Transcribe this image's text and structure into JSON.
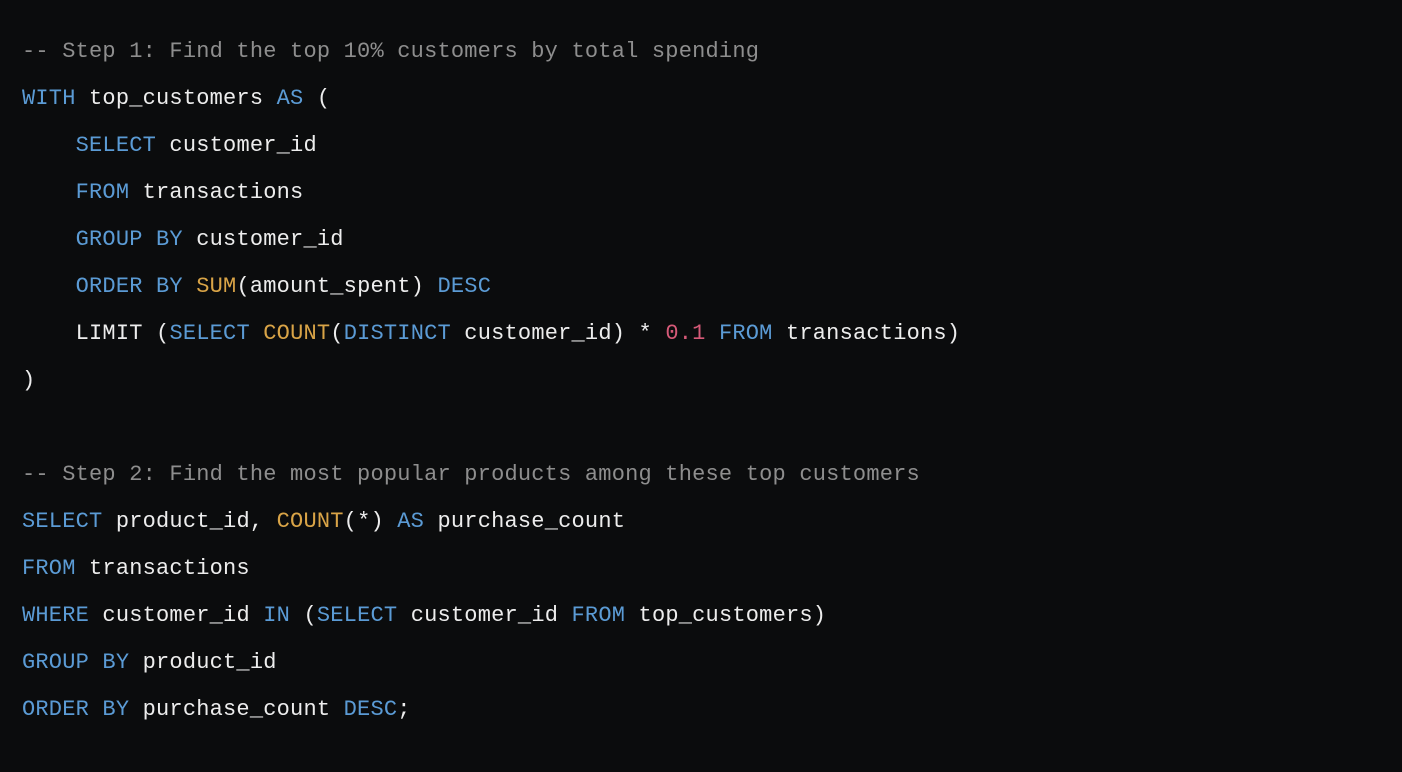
{
  "code": {
    "lines": [
      [
        {
          "cls": "tok-comment",
          "text": "-- Step 1: Find the top 10% customers by total spending"
        }
      ],
      [
        {
          "cls": "tok-keyword",
          "text": "WITH"
        },
        {
          "cls": "tok-default",
          "text": " top_customers "
        },
        {
          "cls": "tok-keyword",
          "text": "AS"
        },
        {
          "cls": "tok-default",
          "text": " ("
        }
      ],
      [
        {
          "cls": "tok-default",
          "text": "    "
        },
        {
          "cls": "tok-keyword",
          "text": "SELECT"
        },
        {
          "cls": "tok-default",
          "text": " customer_id"
        }
      ],
      [
        {
          "cls": "tok-default",
          "text": "    "
        },
        {
          "cls": "tok-keyword",
          "text": "FROM"
        },
        {
          "cls": "tok-default",
          "text": " transactions"
        }
      ],
      [
        {
          "cls": "tok-default",
          "text": "    "
        },
        {
          "cls": "tok-keyword",
          "text": "GROUP BY"
        },
        {
          "cls": "tok-default",
          "text": " customer_id"
        }
      ],
      [
        {
          "cls": "tok-default",
          "text": "    "
        },
        {
          "cls": "tok-keyword",
          "text": "ORDER BY"
        },
        {
          "cls": "tok-default",
          "text": " "
        },
        {
          "cls": "tok-func",
          "text": "SUM"
        },
        {
          "cls": "tok-default",
          "text": "(amount_spent) "
        },
        {
          "cls": "tok-keyword",
          "text": "DESC"
        }
      ],
      [
        {
          "cls": "tok-default",
          "text": "    LIMIT ("
        },
        {
          "cls": "tok-keyword",
          "text": "SELECT"
        },
        {
          "cls": "tok-default",
          "text": " "
        },
        {
          "cls": "tok-func",
          "text": "COUNT"
        },
        {
          "cls": "tok-default",
          "text": "("
        },
        {
          "cls": "tok-keyword",
          "text": "DISTINCT"
        },
        {
          "cls": "tok-default",
          "text": " customer_id) * "
        },
        {
          "cls": "tok-number",
          "text": "0.1"
        },
        {
          "cls": "tok-default",
          "text": " "
        },
        {
          "cls": "tok-keyword",
          "text": "FROM"
        },
        {
          "cls": "tok-default",
          "text": " transactions)"
        }
      ],
      [
        {
          "cls": "tok-default",
          "text": ")"
        }
      ],
      [
        {
          "cls": "tok-default",
          "text": ""
        }
      ],
      [
        {
          "cls": "tok-comment",
          "text": "-- Step 2: Find the most popular products among these top customers"
        }
      ],
      [
        {
          "cls": "tok-keyword",
          "text": "SELECT"
        },
        {
          "cls": "tok-default",
          "text": " product_id, "
        },
        {
          "cls": "tok-func",
          "text": "COUNT"
        },
        {
          "cls": "tok-default",
          "text": "(*) "
        },
        {
          "cls": "tok-keyword",
          "text": "AS"
        },
        {
          "cls": "tok-default",
          "text": " purchase_count"
        }
      ],
      [
        {
          "cls": "tok-keyword",
          "text": "FROM"
        },
        {
          "cls": "tok-default",
          "text": " transactions"
        }
      ],
      [
        {
          "cls": "tok-keyword",
          "text": "WHERE"
        },
        {
          "cls": "tok-default",
          "text": " customer_id "
        },
        {
          "cls": "tok-keyword",
          "text": "IN"
        },
        {
          "cls": "tok-default",
          "text": " ("
        },
        {
          "cls": "tok-keyword",
          "text": "SELECT"
        },
        {
          "cls": "tok-default",
          "text": " customer_id "
        },
        {
          "cls": "tok-keyword",
          "text": "FROM"
        },
        {
          "cls": "tok-default",
          "text": " top_customers)"
        }
      ],
      [
        {
          "cls": "tok-keyword",
          "text": "GROUP BY"
        },
        {
          "cls": "tok-default",
          "text": " product_id"
        }
      ],
      [
        {
          "cls": "tok-keyword",
          "text": "ORDER BY"
        },
        {
          "cls": "tok-default",
          "text": " purchase_count "
        },
        {
          "cls": "tok-keyword",
          "text": "DESC"
        },
        {
          "cls": "tok-default",
          "text": ";"
        }
      ]
    ]
  }
}
